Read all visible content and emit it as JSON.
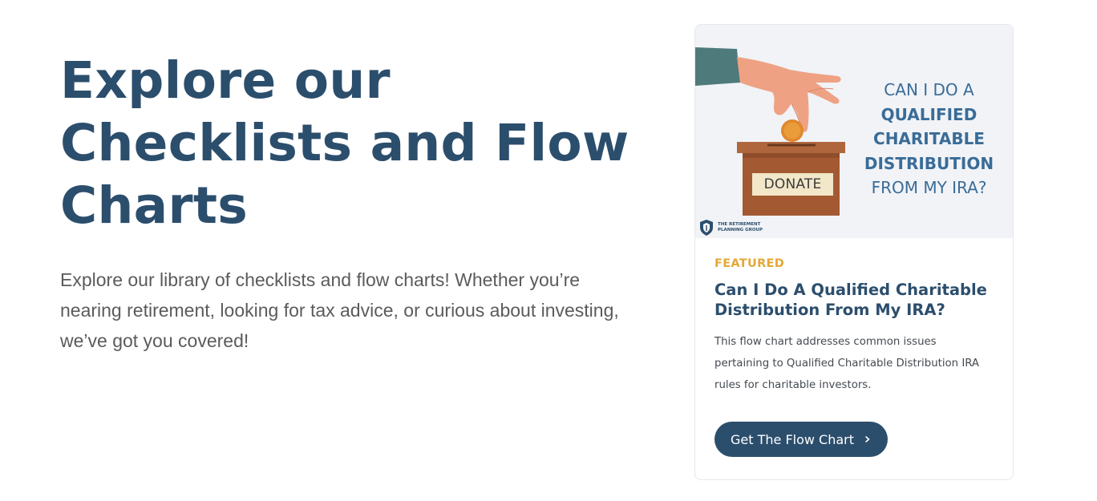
{
  "hero": {
    "title": "Explore our Checklists and Flow Charts",
    "description": "Explore our library of checklists and flow charts! Whether you’re nearing retirement, looking for tax advice, or curious about investing, we’ve got you covered!"
  },
  "card": {
    "image": {
      "headline_line1": "CAN I DO A",
      "headline_line2": "QUALIFIED",
      "headline_line3": "CHARITABLE",
      "headline_line4": "DISTRIBUTION",
      "headline_line5": "FROM MY IRA?",
      "donate_label": "DONATE",
      "brand_line1": "THE RETIREMENT",
      "brand_line2": "PLANNING GROUP"
    },
    "tag": "FEATURED",
    "title": "Can I Do A Qualified Charitable Distribution From My IRA?",
    "description": "This flow chart addresses common issues pertaining to Qualified Charitable Distribution IRA rules for charitable investors.",
    "cta_label": "Get The Flow Chart",
    "cta_icon": "chevron-right-icon"
  },
  "colors": {
    "primary": "#2c4e6d",
    "accent": "#e3a838",
    "image_background": "#f1f3f7"
  }
}
